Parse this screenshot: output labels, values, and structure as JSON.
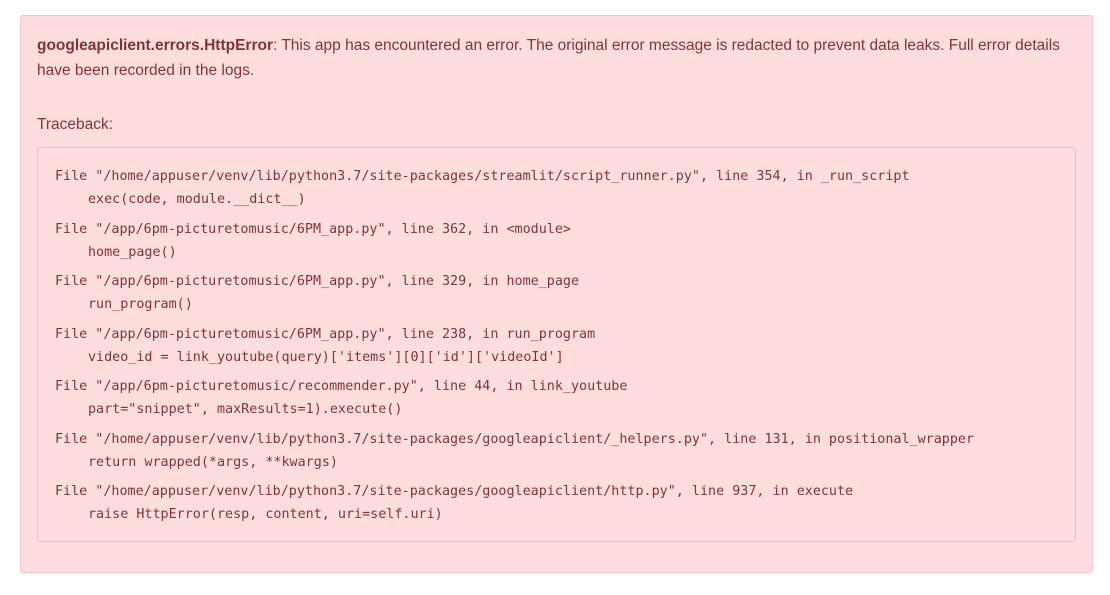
{
  "error": {
    "exception_type": "googleapiclient.errors.HttpError",
    "message_suffix": ": This app has encountered an error. The original error message is redacted to prevent data leaks. Full error details have been recorded in the logs.",
    "traceback_label": "Traceback:",
    "frames": [
      {
        "location": "File \"/home/appuser/venv/lib/python3.7/site-packages/streamlit/script_runner.py\", line 354, in _run_script",
        "code": "exec(code, module.__dict__)"
      },
      {
        "location": "File \"/app/6pm-picturetomusic/6PM_app.py\", line 362, in <module>",
        "code": "home_page()"
      },
      {
        "location": "File \"/app/6pm-picturetomusic/6PM_app.py\", line 329, in home_page",
        "code": "run_program()"
      },
      {
        "location": "File \"/app/6pm-picturetomusic/6PM_app.py\", line 238, in run_program",
        "code": "video_id = link_youtube(query)['items'][0]['id']['videoId']"
      },
      {
        "location": "File \"/app/6pm-picturetomusic/recommender.py\", line 44, in link_youtube",
        "code": "part=\"snippet\", maxResults=1).execute()"
      },
      {
        "location": "File \"/home/appuser/venv/lib/python3.7/site-packages/googleapiclient/_helpers.py\", line 131, in positional_wrapper",
        "code": "return wrapped(*args, **kwargs)"
      },
      {
        "location": "File \"/home/appuser/venv/lib/python3.7/site-packages/googleapiclient/http.py\", line 937, in execute",
        "code": "raise HttpError(resp, content, uri=self.uri)"
      }
    ]
  },
  "colors": {
    "background": "#fddddd",
    "border": "#f5c2c7",
    "text": "#7d353b"
  }
}
